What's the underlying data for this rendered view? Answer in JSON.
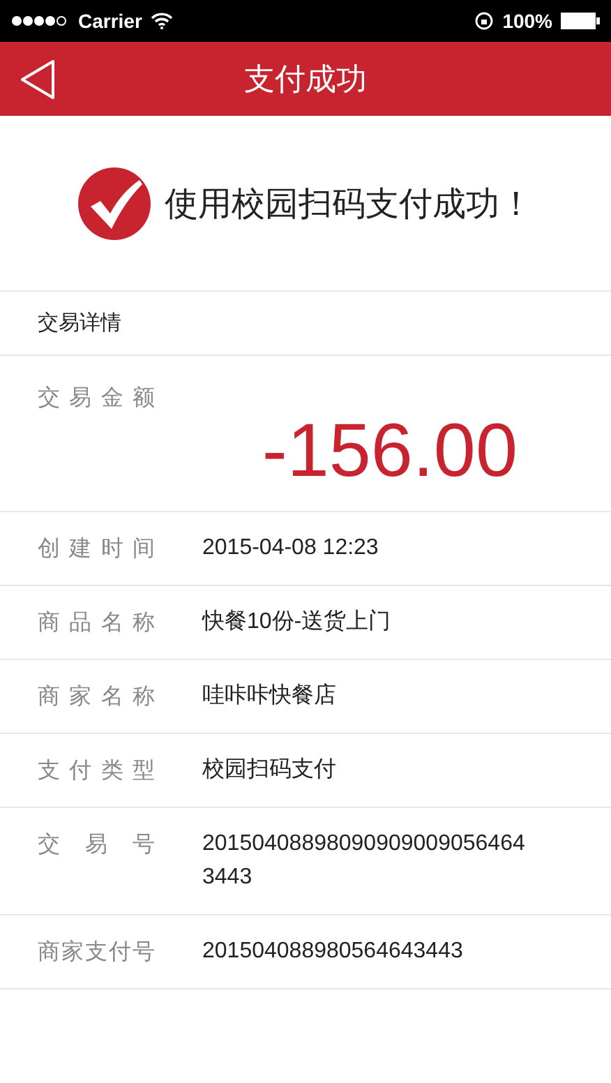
{
  "status_bar": {
    "carrier": "Carrier",
    "battery": "100%"
  },
  "header": {
    "title": "支付成功"
  },
  "result": {
    "message": "使用校园扫码支付成功！"
  },
  "section_title": "交易详情",
  "amount": {
    "label": "交易金额",
    "value": "-156.00"
  },
  "details": [
    {
      "label": "创建时间",
      "value": "2015-04-08 12:23"
    },
    {
      "label": "商品名称",
      "value": "快餐10份-送货上门"
    },
    {
      "label": "商家名称",
      "value": "哇咔咔快餐店"
    },
    {
      "label": "支付类型",
      "value": "校园扫码支付"
    },
    {
      "label": "交易号",
      "value": "201504088980909090090564643443"
    },
    {
      "label": "商家支付号",
      "value": "201504088980564643443"
    }
  ]
}
